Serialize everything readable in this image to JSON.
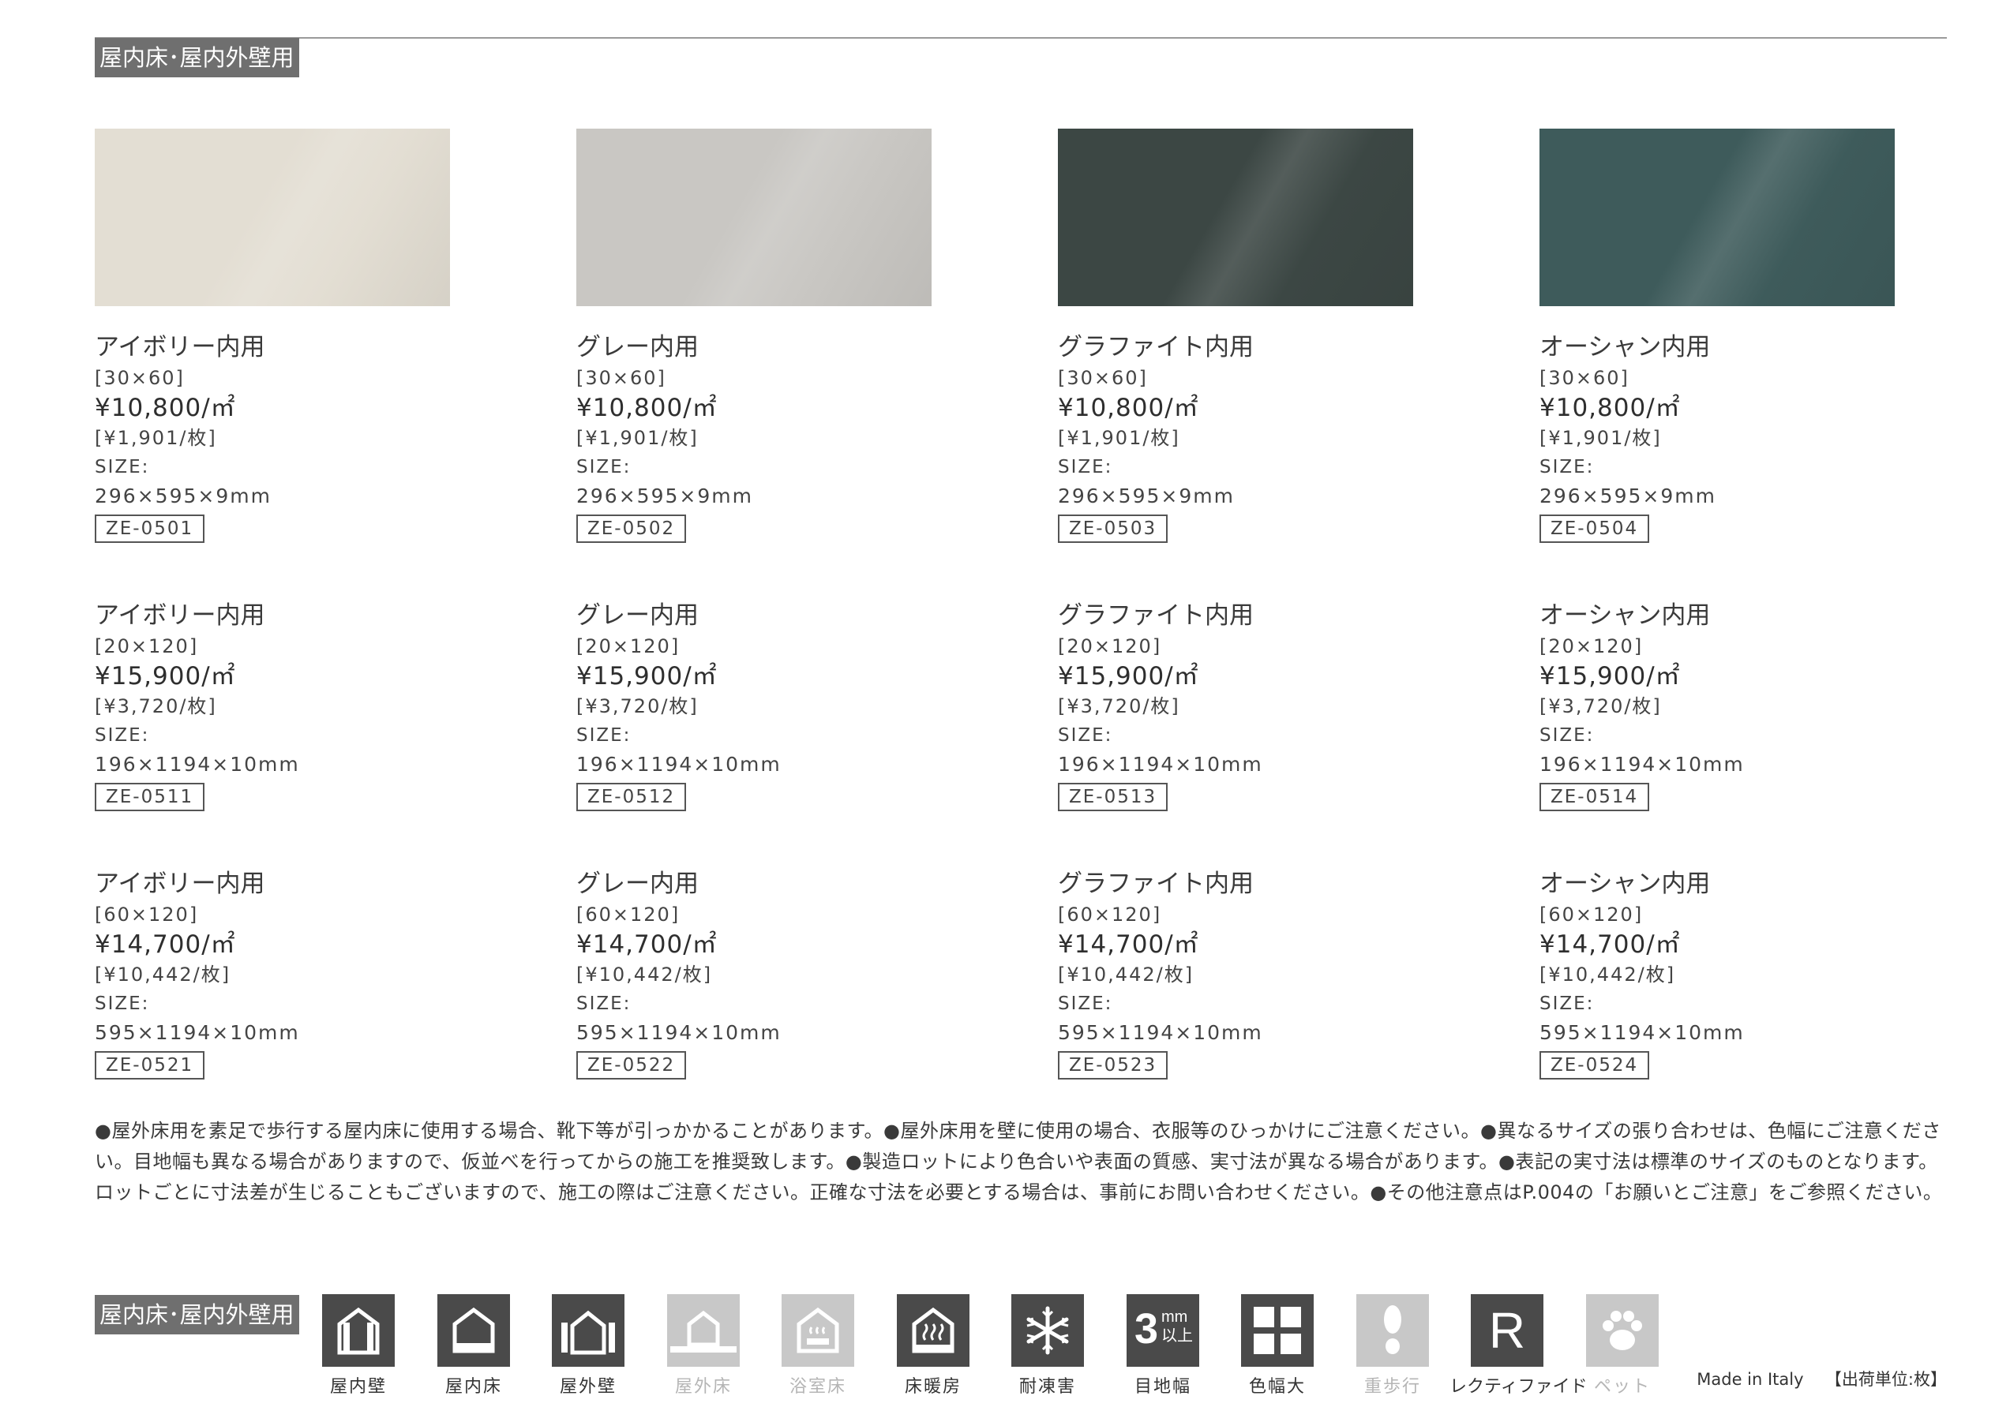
{
  "section_tag": "屋内床･屋内外壁用",
  "columns": [
    {
      "swatch_color": "#e3ded3",
      "items": [
        {
          "name": "アイボリー内用",
          "dim": "[30×60]",
          "price": "¥10,800/㎡",
          "per_piece": "[¥1,901/枚]",
          "size_label": "SIZE:",
          "size": "296×595×9mm",
          "code": "ZE-0501"
        },
        {
          "name": "アイボリー内用",
          "dim": "[20×120]",
          "price": "¥15,900/㎡",
          "per_piece": "[¥3,720/枚]",
          "size_label": "SIZE:",
          "size": "196×1194×10mm",
          "code": "ZE-0511"
        },
        {
          "name": "アイボリー内用",
          "dim": "[60×120]",
          "price": "¥14,700/㎡",
          "per_piece": "[¥10,442/枚]",
          "size_label": "SIZE:",
          "size": "595×1194×10mm",
          "code": "ZE-0521"
        }
      ]
    },
    {
      "swatch_color": "#c9c7c3",
      "items": [
        {
          "name": "グレー内用",
          "dim": "[30×60]",
          "price": "¥10,800/㎡",
          "per_piece": "[¥1,901/枚]",
          "size_label": "SIZE:",
          "size": "296×595×9mm",
          "code": "ZE-0502"
        },
        {
          "name": "グレー内用",
          "dim": "[20×120]",
          "price": "¥15,900/㎡",
          "per_piece": "[¥3,720/枚]",
          "size_label": "SIZE:",
          "size": "196×1194×10mm",
          "code": "ZE-0512"
        },
        {
          "name": "グレー内用",
          "dim": "[60×120]",
          "price": "¥14,700/㎡",
          "per_piece": "[¥10,442/枚]",
          "size_label": "SIZE:",
          "size": "595×1194×10mm",
          "code": "ZE-0522"
        }
      ]
    },
    {
      "swatch_color": "#3c4744",
      "items": [
        {
          "name": "グラファイト内用",
          "dim": "[30×60]",
          "price": "¥10,800/㎡",
          "per_piece": "[¥1,901/枚]",
          "size_label": "SIZE:",
          "size": "296×595×9mm",
          "code": "ZE-0503"
        },
        {
          "name": "グラファイト内用",
          "dim": "[20×120]",
          "price": "¥15,900/㎡",
          "per_piece": "[¥3,720/枚]",
          "size_label": "SIZE:",
          "size": "196×1194×10mm",
          "code": "ZE-0513"
        },
        {
          "name": "グラファイト内用",
          "dim": "[60×120]",
          "price": "¥14,700/㎡",
          "per_piece": "[¥10,442/枚]",
          "size_label": "SIZE:",
          "size": "595×1194×10mm",
          "code": "ZE-0523"
        }
      ]
    },
    {
      "swatch_color": "#3e5b5b",
      "items": [
        {
          "name": "オーシャン内用",
          "dim": "[30×60]",
          "price": "¥10,800/㎡",
          "per_piece": "[¥1,901/枚]",
          "size_label": "SIZE:",
          "size": "296×595×9mm",
          "code": "ZE-0504"
        },
        {
          "name": "オーシャン内用",
          "dim": "[20×120]",
          "price": "¥15,900/㎡",
          "per_piece": "[¥3,720/枚]",
          "size_label": "SIZE:",
          "size": "196×1194×10mm",
          "code": "ZE-0514"
        },
        {
          "name": "オーシャン内用",
          "dim": "[60×120]",
          "price": "¥14,700/㎡",
          "per_piece": "[¥10,442/枚]",
          "size_label": "SIZE:",
          "size": "595×1194×10mm",
          "code": "ZE-0524"
        }
      ]
    }
  ],
  "notes": "●屋外床用を素足で歩行する屋内床に使用する場合、靴下等が引っかかることがあります。●屋外床用を壁に使用の場合、衣服等のひっかけにご注意ください。●異なるサイズの張り合わせは、色幅にご注意ください。目地幅も異なる場合がありますので、仮並べを行ってからの施工を推奨致します。●製造ロットにより色合いや表面の質感、実寸法が異なる場合があります。●表記の実寸法は標準のサイズのものとなります。ロットごとに寸法差が生じることもございますので、施工の際はご注意ください。正確な寸法を必要とする場合は、事前にお問い合わせください。●その他注意点はP.004の「お願いとご注意」をご参照ください。",
  "usage_tag": "屋内床･屋内外壁用",
  "usage_icons": [
    {
      "label": "屋内壁",
      "icon": "indoor-wall-icon",
      "active": true
    },
    {
      "label": "屋内床",
      "icon": "indoor-floor-icon",
      "active": true
    },
    {
      "label": "屋外壁",
      "icon": "outdoor-wall-icon",
      "active": true
    },
    {
      "label": "屋外床",
      "icon": "outdoor-floor-icon",
      "active": false
    },
    {
      "label": "浴室床",
      "icon": "bathroom-floor-icon",
      "active": false
    },
    {
      "label": "床暖房",
      "icon": "floor-heating-icon",
      "active": true
    },
    {
      "label": "耐凍害",
      "icon": "frost-resistant-icon",
      "active": true
    },
    {
      "label": "目地幅",
      "icon": "joint-width-icon",
      "active": true,
      "text_main": "3",
      "text_unit": "mm",
      "text_sub": "以上"
    },
    {
      "label": "色幅大",
      "icon": "color-variation-icon",
      "active": true
    },
    {
      "label": "重歩行",
      "icon": "heavy-walking-icon",
      "active": false
    },
    {
      "label": "レクティファイド",
      "icon": "rectified-icon",
      "active": true,
      "text_main": "R"
    },
    {
      "label": "ペット",
      "icon": "pet-icon",
      "active": false
    }
  ],
  "footer": {
    "origin": "Made in Italy",
    "unit": "【出荷単位:枚】"
  },
  "colors": {
    "icon_active": "#4a4a4a",
    "icon_inactive": "#c8c8c8",
    "label_active": "#333333",
    "label_inactive": "#b5b5b5",
    "tag_bg": "#6f6f6f"
  }
}
